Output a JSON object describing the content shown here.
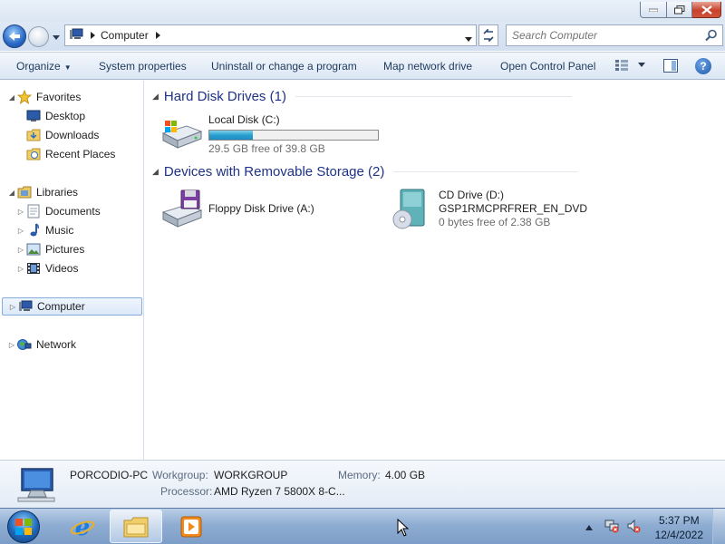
{
  "address": {
    "breadcrumb": "Computer",
    "search_placeholder": "Search Computer"
  },
  "commandbar": {
    "organize": "Organize",
    "system_properties": "System properties",
    "uninstall": "Uninstall or change a program",
    "map_drive": "Map network drive",
    "control_panel": "Open Control Panel"
  },
  "nav": {
    "favorites": "Favorites",
    "desktop": "Desktop",
    "downloads": "Downloads",
    "recent_places": "Recent Places",
    "libraries": "Libraries",
    "documents": "Documents",
    "music": "Music",
    "pictures": "Pictures",
    "videos": "Videos",
    "computer": "Computer",
    "network": "Network"
  },
  "groups": {
    "hdd": "Hard Disk Drives (1)",
    "removable": "Devices with Removable Storage (2)"
  },
  "drives": {
    "c": {
      "name": "Local Disk (C:)",
      "free": "29.5 GB free of 39.8 GB",
      "used_fraction": 0.26
    },
    "a": {
      "name": "Floppy Disk Drive (A:)"
    },
    "d": {
      "name": "CD Drive (D:)",
      "label": "GSP1RMCPRFRER_EN_DVD",
      "free": "0 bytes free of 2.38 GB"
    }
  },
  "details": {
    "pc_name": "PORCODIO-PC",
    "workgroup_label": "Workgroup:",
    "workgroup": "WORKGROUP",
    "memory_label": "Memory:",
    "memory": "4.00 GB",
    "processor_label": "Processor:",
    "processor": "AMD Ryzen 7 5800X 8-C..."
  },
  "taskbar": {
    "time": "5:37 PM",
    "date": "12/4/2022"
  },
  "colors": {
    "link_blue": "#1e3287",
    "progress_fill": "#2a9fd0"
  }
}
